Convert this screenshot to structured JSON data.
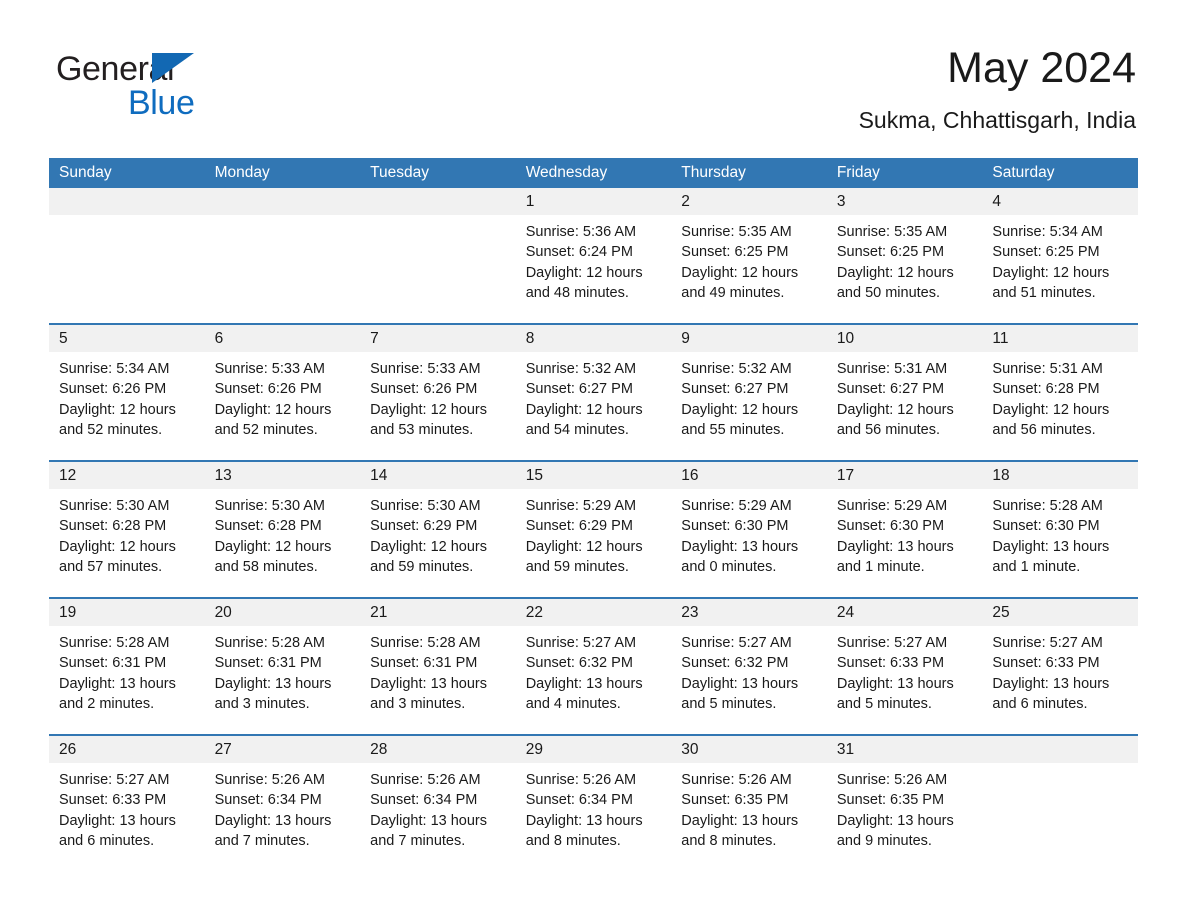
{
  "logo": {
    "text_primary": "General",
    "text_secondary": "Blue",
    "primary_color": "#231f20",
    "secondary_color": "#0f6cbf",
    "triangle_color": "#1268b3"
  },
  "header": {
    "month_title": "May 2024",
    "location": "Sukma, Chhattisgarh, India"
  },
  "calendar": {
    "header_color": "#3277b3",
    "daynum_band_color": "#f1f1f1",
    "weekdays": [
      "Sunday",
      "Monday",
      "Tuesday",
      "Wednesday",
      "Thursday",
      "Friday",
      "Saturday"
    ],
    "weeks": [
      [
        {
          "day": "",
          "blank": true
        },
        {
          "day": "",
          "blank": true
        },
        {
          "day": "",
          "blank": true
        },
        {
          "day": "1",
          "sunrise": "Sunrise: 5:36 AM",
          "sunset": "Sunset: 6:24 PM",
          "daylight_line1": "Daylight: 12 hours",
          "daylight_line2": "and 48 minutes."
        },
        {
          "day": "2",
          "sunrise": "Sunrise: 5:35 AM",
          "sunset": "Sunset: 6:25 PM",
          "daylight_line1": "Daylight: 12 hours",
          "daylight_line2": "and 49 minutes."
        },
        {
          "day": "3",
          "sunrise": "Sunrise: 5:35 AM",
          "sunset": "Sunset: 6:25 PM",
          "daylight_line1": "Daylight: 12 hours",
          "daylight_line2": "and 50 minutes."
        },
        {
          "day": "4",
          "sunrise": "Sunrise: 5:34 AM",
          "sunset": "Sunset: 6:25 PM",
          "daylight_line1": "Daylight: 12 hours",
          "daylight_line2": "and 51 minutes."
        }
      ],
      [
        {
          "day": "5",
          "sunrise": "Sunrise: 5:34 AM",
          "sunset": "Sunset: 6:26 PM",
          "daylight_line1": "Daylight: 12 hours",
          "daylight_line2": "and 52 minutes."
        },
        {
          "day": "6",
          "sunrise": "Sunrise: 5:33 AM",
          "sunset": "Sunset: 6:26 PM",
          "daylight_line1": "Daylight: 12 hours",
          "daylight_line2": "and 52 minutes."
        },
        {
          "day": "7",
          "sunrise": "Sunrise: 5:33 AM",
          "sunset": "Sunset: 6:26 PM",
          "daylight_line1": "Daylight: 12 hours",
          "daylight_line2": "and 53 minutes."
        },
        {
          "day": "8",
          "sunrise": "Sunrise: 5:32 AM",
          "sunset": "Sunset: 6:27 PM",
          "daylight_line1": "Daylight: 12 hours",
          "daylight_line2": "and 54 minutes."
        },
        {
          "day": "9",
          "sunrise": "Sunrise: 5:32 AM",
          "sunset": "Sunset: 6:27 PM",
          "daylight_line1": "Daylight: 12 hours",
          "daylight_line2": "and 55 minutes."
        },
        {
          "day": "10",
          "sunrise": "Sunrise: 5:31 AM",
          "sunset": "Sunset: 6:27 PM",
          "daylight_line1": "Daylight: 12 hours",
          "daylight_line2": "and 56 minutes."
        },
        {
          "day": "11",
          "sunrise": "Sunrise: 5:31 AM",
          "sunset": "Sunset: 6:28 PM",
          "daylight_line1": "Daylight: 12 hours",
          "daylight_line2": "and 56 minutes."
        }
      ],
      [
        {
          "day": "12",
          "sunrise": "Sunrise: 5:30 AM",
          "sunset": "Sunset: 6:28 PM",
          "daylight_line1": "Daylight: 12 hours",
          "daylight_line2": "and 57 minutes."
        },
        {
          "day": "13",
          "sunrise": "Sunrise: 5:30 AM",
          "sunset": "Sunset: 6:28 PM",
          "daylight_line1": "Daylight: 12 hours",
          "daylight_line2": "and 58 minutes."
        },
        {
          "day": "14",
          "sunrise": "Sunrise: 5:30 AM",
          "sunset": "Sunset: 6:29 PM",
          "daylight_line1": "Daylight: 12 hours",
          "daylight_line2": "and 59 minutes."
        },
        {
          "day": "15",
          "sunrise": "Sunrise: 5:29 AM",
          "sunset": "Sunset: 6:29 PM",
          "daylight_line1": "Daylight: 12 hours",
          "daylight_line2": "and 59 minutes."
        },
        {
          "day": "16",
          "sunrise": "Sunrise: 5:29 AM",
          "sunset": "Sunset: 6:30 PM",
          "daylight_line1": "Daylight: 13 hours",
          "daylight_line2": "and 0 minutes."
        },
        {
          "day": "17",
          "sunrise": "Sunrise: 5:29 AM",
          "sunset": "Sunset: 6:30 PM",
          "daylight_line1": "Daylight: 13 hours",
          "daylight_line2": "and 1 minute."
        },
        {
          "day": "18",
          "sunrise": "Sunrise: 5:28 AM",
          "sunset": "Sunset: 6:30 PM",
          "daylight_line1": "Daylight: 13 hours",
          "daylight_line2": "and 1 minute."
        }
      ],
      [
        {
          "day": "19",
          "sunrise": "Sunrise: 5:28 AM",
          "sunset": "Sunset: 6:31 PM",
          "daylight_line1": "Daylight: 13 hours",
          "daylight_line2": "and 2 minutes."
        },
        {
          "day": "20",
          "sunrise": "Sunrise: 5:28 AM",
          "sunset": "Sunset: 6:31 PM",
          "daylight_line1": "Daylight: 13 hours",
          "daylight_line2": "and 3 minutes."
        },
        {
          "day": "21",
          "sunrise": "Sunrise: 5:28 AM",
          "sunset": "Sunset: 6:31 PM",
          "daylight_line1": "Daylight: 13 hours",
          "daylight_line2": "and 3 minutes."
        },
        {
          "day": "22",
          "sunrise": "Sunrise: 5:27 AM",
          "sunset": "Sunset: 6:32 PM",
          "daylight_line1": "Daylight: 13 hours",
          "daylight_line2": "and 4 minutes."
        },
        {
          "day": "23",
          "sunrise": "Sunrise: 5:27 AM",
          "sunset": "Sunset: 6:32 PM",
          "daylight_line1": "Daylight: 13 hours",
          "daylight_line2": "and 5 minutes."
        },
        {
          "day": "24",
          "sunrise": "Sunrise: 5:27 AM",
          "sunset": "Sunset: 6:33 PM",
          "daylight_line1": "Daylight: 13 hours",
          "daylight_line2": "and 5 minutes."
        },
        {
          "day": "25",
          "sunrise": "Sunrise: 5:27 AM",
          "sunset": "Sunset: 6:33 PM",
          "daylight_line1": "Daylight: 13 hours",
          "daylight_line2": "and 6 minutes."
        }
      ],
      [
        {
          "day": "26",
          "sunrise": "Sunrise: 5:27 AM",
          "sunset": "Sunset: 6:33 PM",
          "daylight_line1": "Daylight: 13 hours",
          "daylight_line2": "and 6 minutes."
        },
        {
          "day": "27",
          "sunrise": "Sunrise: 5:26 AM",
          "sunset": "Sunset: 6:34 PM",
          "daylight_line1": "Daylight: 13 hours",
          "daylight_line2": "and 7 minutes."
        },
        {
          "day": "28",
          "sunrise": "Sunrise: 5:26 AM",
          "sunset": "Sunset: 6:34 PM",
          "daylight_line1": "Daylight: 13 hours",
          "daylight_line2": "and 7 minutes."
        },
        {
          "day": "29",
          "sunrise": "Sunrise: 5:26 AM",
          "sunset": "Sunset: 6:34 PM",
          "daylight_line1": "Daylight: 13 hours",
          "daylight_line2": "and 8 minutes."
        },
        {
          "day": "30",
          "sunrise": "Sunrise: 5:26 AM",
          "sunset": "Sunset: 6:35 PM",
          "daylight_line1": "Daylight: 13 hours",
          "daylight_line2": "and 8 minutes."
        },
        {
          "day": "31",
          "sunrise": "Sunrise: 5:26 AM",
          "sunset": "Sunset: 6:35 PM",
          "daylight_line1": "Daylight: 13 hours",
          "daylight_line2": "and 9 minutes."
        },
        {
          "day": "",
          "blank": true
        }
      ]
    ]
  }
}
